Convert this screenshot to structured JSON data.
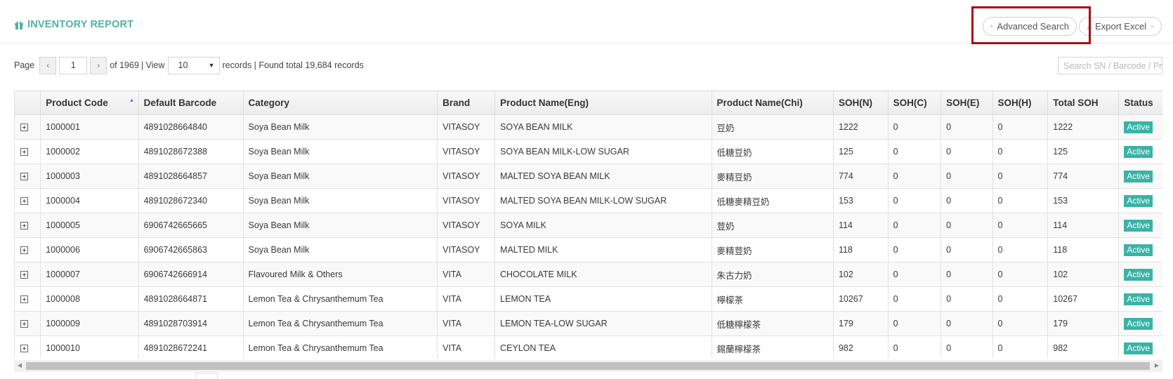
{
  "header": {
    "title": "INVENTORY REPORT",
    "advanced_search": "Advanced Search",
    "export_excel": "Export Excel"
  },
  "pager": {
    "page_label": "Page",
    "current_page": "1",
    "of_text": "of 1969",
    "view_label": "| View",
    "per_page": "10",
    "summary": "records | Found total 19,684 records"
  },
  "search": {
    "placeholder": "Search SN / Barcode / Product"
  },
  "table": {
    "columns": [
      "Product Code",
      "Default Barcode",
      "Category",
      "Brand",
      "Product Name(Eng)",
      "Product Name(Chi)",
      "SOH(N)",
      "SOH(C)",
      "SOH(E)",
      "SOH(H)",
      "Total SOH",
      "Status"
    ],
    "rows": [
      [
        "1000001",
        "4891028664840",
        "Soya Bean Milk",
        "VITASOY",
        "SOYA BEAN MILK",
        "豆奶",
        "1222",
        "0",
        "0",
        "0",
        "1222",
        "Active"
      ],
      [
        "1000002",
        "4891028672388",
        "Soya Bean Milk",
        "VITASOY",
        "SOYA BEAN MILK-LOW SUGAR",
        "低糖豆奶",
        "125",
        "0",
        "0",
        "0",
        "125",
        "Active"
      ],
      [
        "1000003",
        "4891028664857",
        "Soya Bean Milk",
        "VITASOY",
        "MALTED SOYA BEAN MILK",
        "麥精豆奶",
        "774",
        "0",
        "0",
        "0",
        "774",
        "Active"
      ],
      [
        "1000004",
        "4891028672340",
        "Soya Bean Milk",
        "VITASOY",
        "MALTED SOYA BEAN MILK-LOW SUGAR",
        "低糖麥精豆奶",
        "153",
        "0",
        "0",
        "0",
        "153",
        "Active"
      ],
      [
        "1000005",
        "6906742665665",
        "Soya Bean Milk",
        "VITASOY",
        "SOYA MILK",
        "荳奶",
        "114",
        "0",
        "0",
        "0",
        "114",
        "Active"
      ],
      [
        "1000006",
        "6906742665863",
        "Soya Bean Milk",
        "VITASOY",
        "MALTED MILK",
        "麥精荳奶",
        "118",
        "0",
        "0",
        "0",
        "118",
        "Active"
      ],
      [
        "1000007",
        "6906742666914",
        "Flavoured Milk & Others",
        "VITA",
        "CHOCOLATE MILK",
        "朱古力奶",
        "102",
        "0",
        "0",
        "0",
        "102",
        "Active"
      ],
      [
        "1000008",
        "4891028664871",
        "Lemon Tea & Chrysanthemum Tea",
        "VITA",
        "LEMON TEA",
        "檸檬茶",
        "10267",
        "0",
        "0",
        "0",
        "10267",
        "Active"
      ],
      [
        "1000009",
        "4891028703914",
        "Lemon Tea & Chrysanthemum Tea",
        "VITA",
        "LEMON TEA-LOW SUGAR",
        "低糖檸檬茶",
        "179",
        "0",
        "0",
        "0",
        "179",
        "Active"
      ],
      [
        "1000010",
        "4891028672241",
        "Lemon Tea & Chrysanthemum Tea",
        "VITA",
        "CEYLON TEA",
        "錫蘭檸檬茶",
        "982",
        "0",
        "0",
        "0",
        "982",
        "Active"
      ]
    ]
  },
  "colors": {
    "accent": "#4fb3a1",
    "badge": "#39b3a6",
    "highlight": "#a31014"
  }
}
